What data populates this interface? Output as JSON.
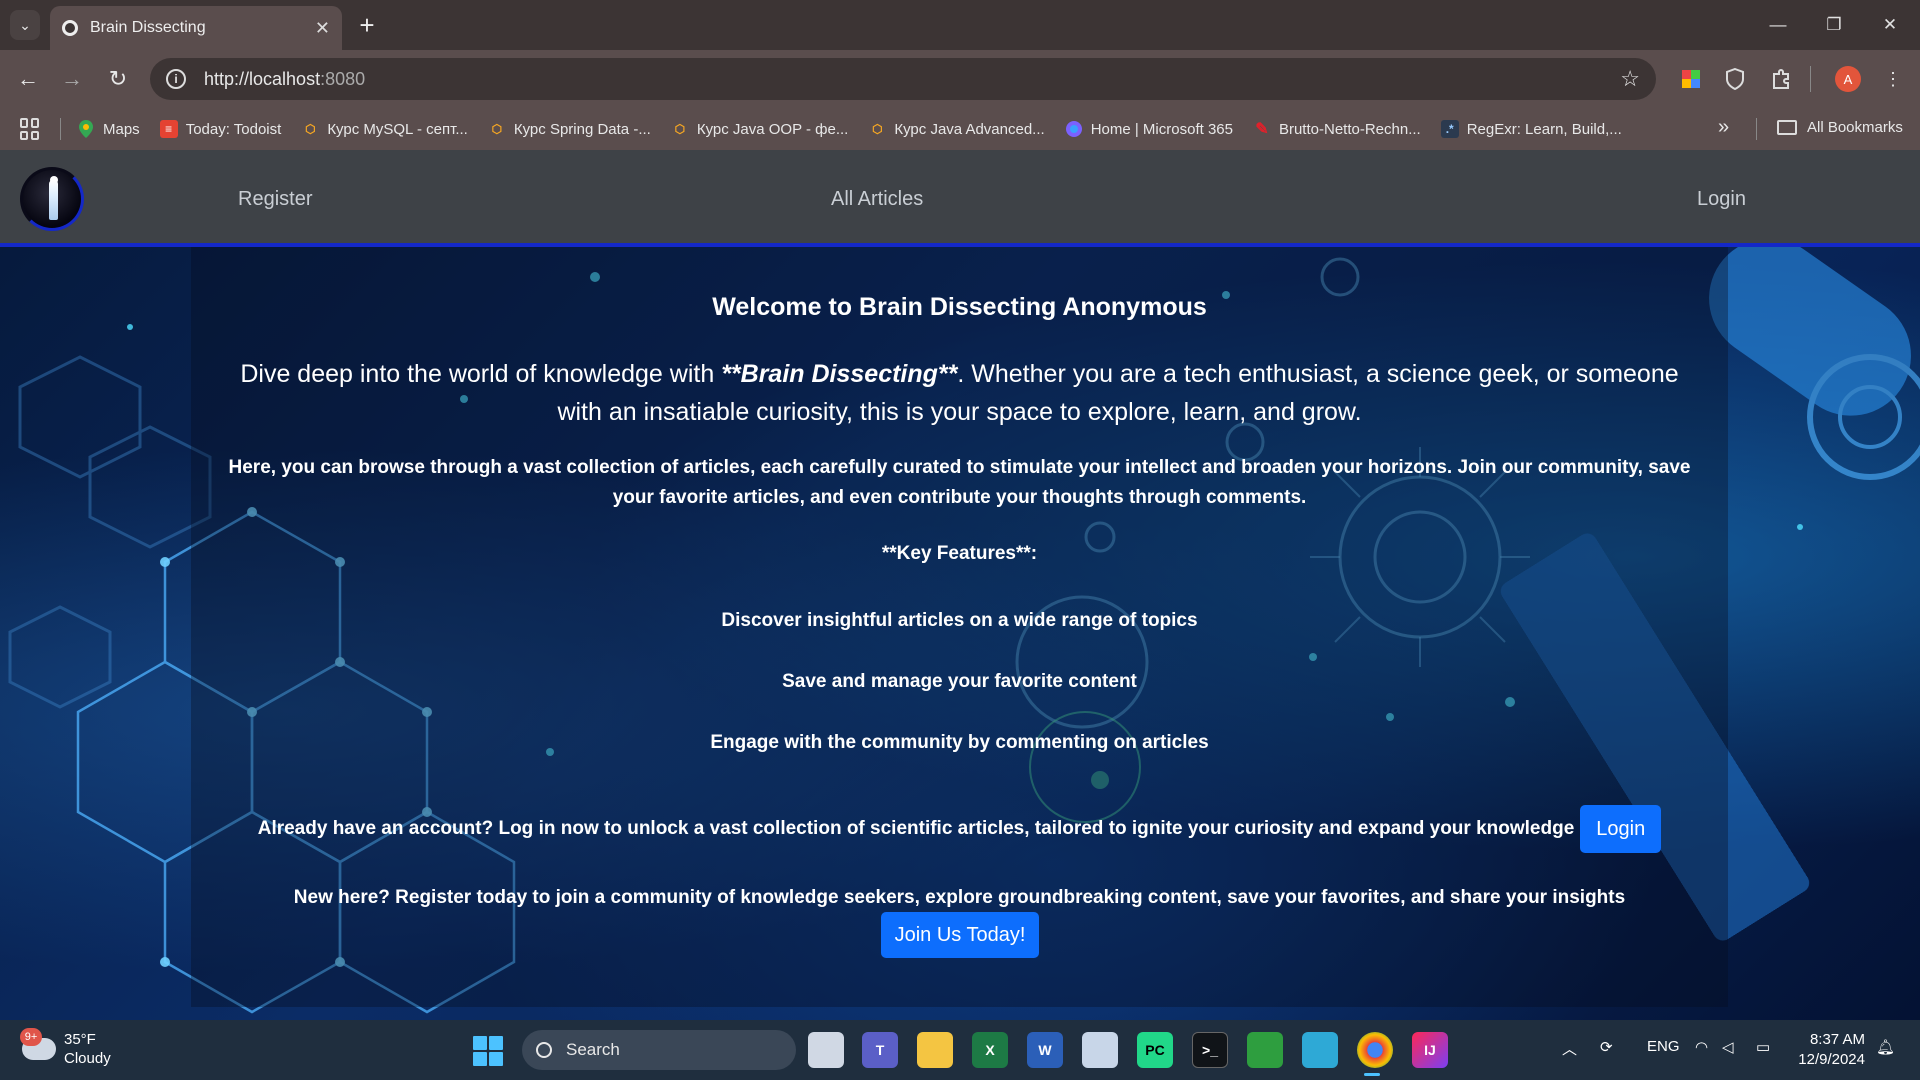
{
  "browser": {
    "tab_title": "Brain Dissecting",
    "new_tab_symbol": "+",
    "url_host": "http://localhost",
    "url_port": ":8080",
    "profile_initial": "A",
    "bookmarks": [
      {
        "label": "Maps",
        "icon": "maps-pin-icon",
        "color": "#ea4335"
      },
      {
        "label": "Today: Todoist",
        "icon": "todoist-icon",
        "color": "#e44332"
      },
      {
        "label": "Курс MySQL - септ...",
        "icon": "course-icon",
        "color": "#f5a623"
      },
      {
        "label": "Курс Spring Data -...",
        "icon": "course-icon",
        "color": "#f5a623"
      },
      {
        "label": "Курс Java OOP - фе...",
        "icon": "course-icon",
        "color": "#f5a623"
      },
      {
        "label": "Курс Java Advanced...",
        "icon": "course-icon",
        "color": "#f5a623"
      },
      {
        "label": "Home | Microsoft 365",
        "icon": "microsoft365-icon",
        "color": "#7b61ff"
      },
      {
        "label": "Brutto-Netto-Rechn...",
        "icon": "calculator-icon",
        "color": "#e3202a"
      },
      {
        "label": "RegExr: Learn, Build,...",
        "icon": "regexr-icon",
        "color": "#3a6fb0"
      }
    ],
    "all_bookmarks": "All Bookmarks"
  },
  "site": {
    "nav": {
      "register": "Register",
      "all_articles": "All Articles",
      "login": "Login"
    },
    "hero": {
      "welcome": "Welcome to Brain Dissecting Anonymous",
      "lead_before": "Dive deep into the world of knowledge with ",
      "lead_emph": "**Brain Dissecting**",
      "lead_after": ". Whether you are a tech enthusiast, a science geek, or someone with an insatiable curiosity, this is your space to explore, learn, and grow.",
      "paragraph": "Here, you can browse through a vast collection of articles, each carefully curated to stimulate your intellect and broaden your horizons. Join our community, save your favorite articles, and even contribute your thoughts through comments.",
      "key_features_title": "**Key Features**:",
      "features": [
        "Discover insightful articles on a wide range of topics",
        "Save and manage your favorite content",
        "Engage with the community by commenting on articles"
      ],
      "login_prompt": "Already have an account? Log in now to unlock a vast collection of scientific articles, tailored to ignite your curiosity and expand your knowledge",
      "login_button": "Login",
      "register_prompt": "New here? Register today to join a community of knowledge seekers, explore groundbreaking content, save your favorites, and share your insights",
      "join_button": "Join Us Today!"
    }
  },
  "taskbar": {
    "weather_badge": "9+",
    "temperature": "35°F",
    "condition": "Cloudy",
    "search_label": "Search",
    "language": "ENG",
    "time": "8:37 AM",
    "date": "12/9/2024"
  },
  "colors": {
    "accent_blue": "#0d6efd",
    "nav_border": "#1428c8",
    "nav_bg": "#3e4247"
  }
}
